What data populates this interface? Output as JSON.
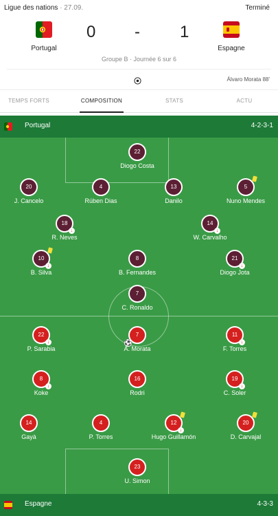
{
  "match": {
    "competition": "Ligue des nations",
    "date": "· 27.09.",
    "status": "Terminé",
    "home_team": "Portugal",
    "away_team": "Espagne",
    "home_score": "0",
    "separator": "-",
    "away_score": "1",
    "info": "Groupe B · Journée 6 sur 6",
    "goal_scorer": "Álvaro Morata 88'"
  },
  "tabs": [
    {
      "label": "TEMPS FORTS",
      "active": false
    },
    {
      "label": "COMPOSITION",
      "active": true
    },
    {
      "label": "STATS",
      "active": false
    },
    {
      "label": "ACTU",
      "active": false
    }
  ],
  "home_lineup": {
    "team": "Portugal",
    "formation": "4-2-3-1",
    "players": [
      {
        "number": "22",
        "name": "Diogo Costa",
        "badges": []
      },
      {
        "number": "20",
        "name": "J. Cancelo",
        "badges": []
      },
      {
        "number": "4",
        "name": "Rúben Dias",
        "badges": []
      },
      {
        "number": "13",
        "name": "Danilo",
        "badges": []
      },
      {
        "number": "5",
        "name": "Nuno Mendes",
        "badges": [
          "yellow-card"
        ]
      },
      {
        "number": "18",
        "name": "R. Neves",
        "badges": [
          "sub-out"
        ]
      },
      {
        "number": "14",
        "name": "W. Carvalho",
        "badges": [
          "sub-out"
        ]
      },
      {
        "number": "10",
        "name": "B. Silva",
        "badges": [
          "yellow-card",
          "sub-out"
        ]
      },
      {
        "number": "8",
        "name": "B. Fernandes",
        "badges": []
      },
      {
        "number": "21",
        "name": "Diogo Jota",
        "badges": [
          "sub-out"
        ]
      },
      {
        "number": "7",
        "name": "C. Ronaldo",
        "badges": []
      }
    ]
  },
  "away_lineup": {
    "team": "Espagne",
    "formation": "4-3-3",
    "players": [
      {
        "number": "22",
        "name": "P. Sarabia",
        "badges": [
          "sub-out"
        ]
      },
      {
        "number": "7",
        "name": "Á. Morata",
        "badges": [
          "goal"
        ]
      },
      {
        "number": "11",
        "name": "F. Torres",
        "badges": [
          "sub-out"
        ]
      },
      {
        "number": "8",
        "name": "Koke",
        "badges": [
          "sub-out"
        ]
      },
      {
        "number": "16",
        "name": "Rodri",
        "badges": []
      },
      {
        "number": "19",
        "name": "C. Soler",
        "badges": [
          "sub-out"
        ]
      },
      {
        "number": "14",
        "name": "Gayà",
        "badges": []
      },
      {
        "number": "4",
        "name": "P. Torres",
        "badges": []
      },
      {
        "number": "12",
        "name": "Hugo Guillamón",
        "badges": [
          "yellow-card",
          "sub-out"
        ]
      },
      {
        "number": "20",
        "name": "D. Carvajal",
        "badges": [
          "yellow-card"
        ]
      },
      {
        "number": "23",
        "name": "U. Simon",
        "badges": []
      }
    ]
  },
  "colors": {
    "pitch": "#3a9b46",
    "team_bar": "#1d7a37",
    "home_player": "#5c1f33",
    "away_player": "#d4201f",
    "yellow_card": "#f2e03a"
  },
  "icons": {
    "sub_out": "down-arrow-icon",
    "goal": "ball-icon",
    "card": "yellow-card-icon"
  }
}
